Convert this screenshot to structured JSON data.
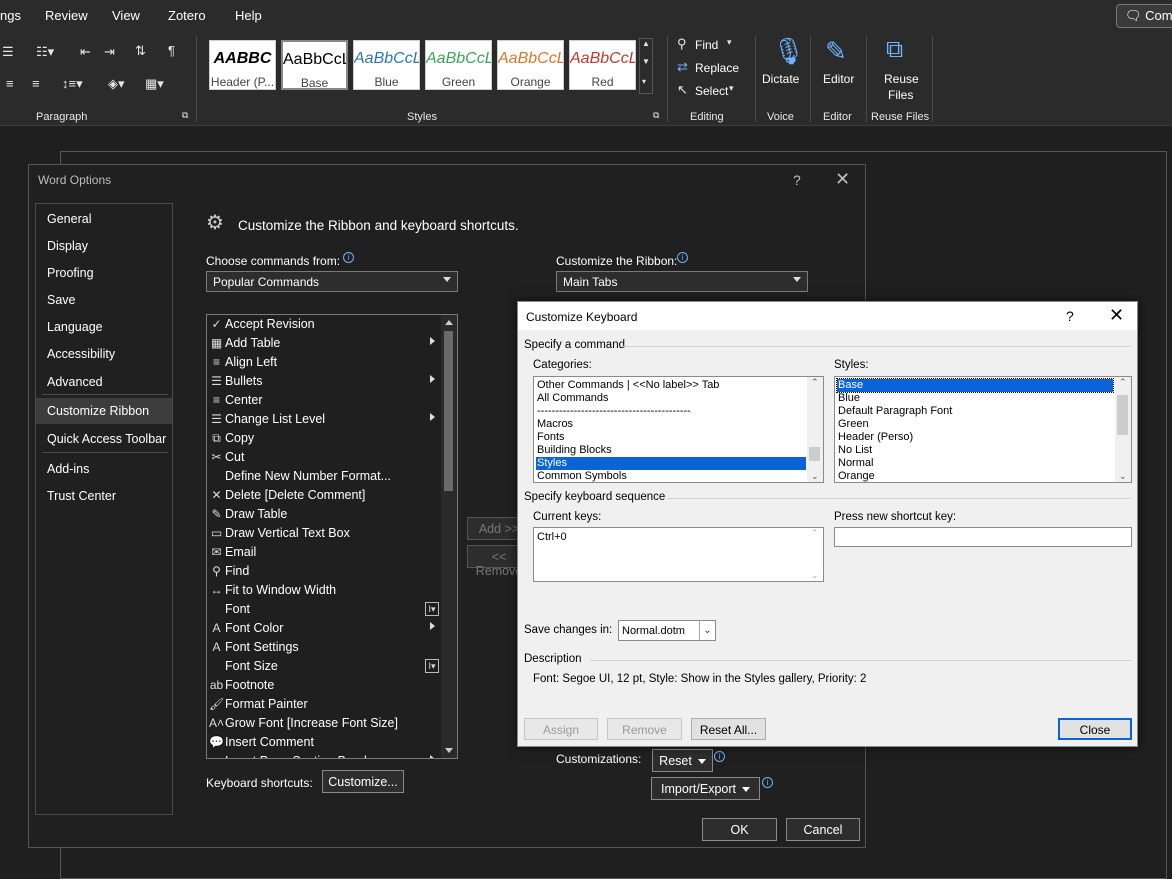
{
  "menubar": {
    "items": [
      "ngs",
      "Review",
      "View",
      "Zotero",
      "Help"
    ],
    "comments_button": "Comm"
  },
  "ribbon": {
    "paragraph_label": "Paragraph",
    "styles_label": "Styles",
    "styles": [
      {
        "sample": "AABBC",
        "name": "Header (P...",
        "color": "#000000"
      },
      {
        "sample": "AaBbCcL",
        "name": "Base",
        "color": "#000000"
      },
      {
        "sample": "AaBbCcL",
        "name": "Blue",
        "color": "#2e75b6"
      },
      {
        "sample": "AaBbCcL",
        "name": "Green",
        "color": "#3aa655"
      },
      {
        "sample": "AaBbCcL",
        "name": "Orange",
        "color": "#d9782d"
      },
      {
        "sample": "AaBbCcL",
        "name": "Red",
        "color": "#c0392b"
      }
    ],
    "editing": {
      "find": "Find",
      "replace": "Replace",
      "select": "Select",
      "label": "Editing"
    },
    "voice": {
      "button": "Dictate",
      "label": "Voice"
    },
    "editor": {
      "button": "Editor",
      "label": "Editor"
    },
    "reuse": {
      "button_line1": "Reuse",
      "button_line2": "Files",
      "label": "Reuse Files"
    }
  },
  "word_options": {
    "title": "Word Options",
    "help": "?",
    "close": "✕",
    "nav": [
      "General",
      "Display",
      "Proofing",
      "Save",
      "Language",
      "Accessibility",
      "Advanced",
      "Customize Ribbon",
      "Quick Access Toolbar",
      "Add-ins",
      "Trust Center"
    ],
    "selected_nav": "Customize Ribbon",
    "heading": "Customize the Ribbon and keyboard shortcuts.",
    "choose_label": "Choose commands from:",
    "choose_value": "Popular Commands",
    "customize_label": "Customize the Ribbon:",
    "customize_value": "Main Tabs",
    "commands": [
      {
        "icon": "accept-revision-icon",
        "glyph": "✓",
        "label": "Accept Revision",
        "extra": ""
      },
      {
        "icon": "add-table-icon",
        "glyph": "▦",
        "label": "Add Table",
        "extra": "sub"
      },
      {
        "icon": "align-left-icon",
        "glyph": "≡",
        "label": "Align Left",
        "extra": ""
      },
      {
        "icon": "bullets-icon",
        "glyph": "☰",
        "label": "Bullets",
        "extra": "sub2"
      },
      {
        "icon": "center-icon",
        "glyph": "≡",
        "label": "Center",
        "extra": ""
      },
      {
        "icon": "change-list-level-icon",
        "glyph": "☰",
        "label": "Change List Level",
        "extra": "sub"
      },
      {
        "icon": "copy-icon",
        "glyph": "⧉",
        "label": "Copy",
        "extra": ""
      },
      {
        "icon": "cut-icon",
        "glyph": "✂",
        "label": "Cut",
        "extra": ""
      },
      {
        "icon": "",
        "glyph": "",
        "label": "Define New Number Format...",
        "extra": ""
      },
      {
        "icon": "delete-comment-icon",
        "glyph": "✕",
        "label": "Delete [Delete Comment]",
        "extra": ""
      },
      {
        "icon": "draw-table-icon",
        "glyph": "✎",
        "label": "Draw Table",
        "extra": ""
      },
      {
        "icon": "draw-vertical-text-box-icon",
        "glyph": "▭",
        "label": "Draw Vertical Text Box",
        "extra": ""
      },
      {
        "icon": "email-icon",
        "glyph": "✉",
        "label": "Email",
        "extra": ""
      },
      {
        "icon": "find-icon",
        "glyph": "⚲",
        "label": "Find",
        "extra": ""
      },
      {
        "icon": "fit-to-window-width-icon",
        "glyph": "↔",
        "label": "Fit to Window Width",
        "extra": ""
      },
      {
        "icon": "",
        "glyph": "",
        "label": "Font",
        "extra": "drop"
      },
      {
        "icon": "font-color-icon",
        "glyph": "A",
        "label": "Font Color",
        "extra": "sub2"
      },
      {
        "icon": "font-settings-icon",
        "glyph": "A",
        "label": "Font Settings",
        "extra": ""
      },
      {
        "icon": "",
        "glyph": "",
        "label": "Font Size",
        "extra": "drop"
      },
      {
        "icon": "footnote-icon",
        "glyph": "ab",
        "label": "Footnote",
        "extra": ""
      },
      {
        "icon": "format-painter-icon",
        "glyph": "🖌",
        "label": "Format Painter",
        "extra": ""
      },
      {
        "icon": "grow-font-icon",
        "glyph": "A˄",
        "label": "Grow Font [Increase Font Size]",
        "extra": ""
      },
      {
        "icon": "insert-comment-icon",
        "glyph": "💬",
        "label": "Insert Comment",
        "extra": ""
      },
      {
        "icon": "insert-page-section-breaks-icon",
        "glyph": "",
        "label": "Insert Page Section Breaks",
        "extra": "sub"
      }
    ],
    "add_button": "Add >>",
    "remove_button": "<< Remove",
    "keyboard_label": "Keyboard shortcuts:",
    "customize_button": "Customize...",
    "customizations_label": "Customizations:",
    "reset_button": "Reset",
    "import_export_button": "Import/Export",
    "ok_button": "OK",
    "cancel_button": "Cancel"
  },
  "customize_keyboard": {
    "title": "Customize Keyboard",
    "help": "?",
    "close": "✕",
    "specify_command": "Specify a command",
    "categories_label": "Categories:",
    "categories": [
      "Other Commands | <<No label>> Tab",
      "All Commands",
      "------------------------------------------",
      "Macros",
      "Fonts",
      "Building Blocks",
      "Styles",
      "Common Symbols"
    ],
    "selected_category": "Styles",
    "styles_label": "Styles:",
    "styles": [
      "Base",
      "Blue",
      "Default Paragraph Font",
      "Green",
      "Header (Perso)",
      "No List",
      "Normal",
      "Orange"
    ],
    "selected_style": "Base",
    "specify_sequence": "Specify keyboard sequence",
    "current_keys_label": "Current keys:",
    "current_keys": [
      "Ctrl+0"
    ],
    "press_new_label": "Press new shortcut key:",
    "press_new_value": "",
    "save_in_label": "Save changes in:",
    "save_in_value": "Normal.dotm",
    "description_label": "Description",
    "description": "Font: Segoe UI, 12 pt, Style: Show in the Styles gallery, Priority: 2",
    "assign_button": "Assign",
    "remove_button": "Remove",
    "reset_all_button": "Reset All...",
    "close_button": "Close"
  }
}
